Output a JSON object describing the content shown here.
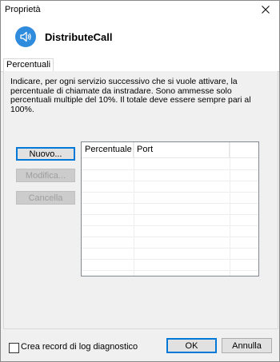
{
  "window": {
    "title": "Proprietà"
  },
  "header": {
    "app_name": "DistributeCall",
    "icon": "speaker-icon"
  },
  "tabs": [
    {
      "label": "Percentuali",
      "selected": true
    }
  ],
  "panel": {
    "description": "Indicare, per ogni servizio successivo che si vuole attivare, la percentuale di chiamate da instradare. Sono ammesse solo percentuali multiple del 10%. Il totale deve essere sempre pari al 100%.",
    "buttons": {
      "new": "Nuovo...",
      "edit": "Modifica...",
      "delete": "Cancella"
    },
    "table": {
      "columns": [
        "Percentuale",
        "Port"
      ],
      "rows": []
    }
  },
  "footer": {
    "checkbox_label": "Crea record di log diagnostico",
    "checkbox_checked": false,
    "ok": "OK",
    "cancel": "Annulla"
  },
  "colors": {
    "accent": "#0078d7",
    "icon_blue": "#2f8bdc"
  }
}
